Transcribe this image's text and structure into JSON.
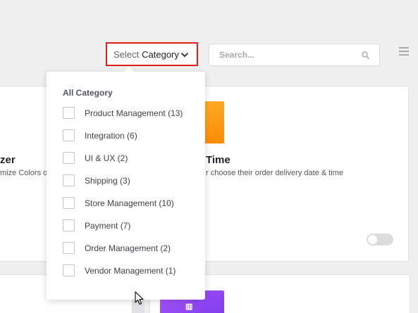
{
  "header": {
    "select_category": {
      "prefix": "Select",
      "strong": "Category",
      "icon": "chevron-down-icon"
    },
    "search": {
      "placeholder": "Search...",
      "value": "",
      "icon": "search-icon"
    },
    "menu_icon": "menu-icon"
  },
  "dropdown": {
    "heading": "All Category",
    "items": [
      {
        "label": "Product Management (13)",
        "checked": false
      },
      {
        "label": "Integration (6)",
        "checked": false
      },
      {
        "label": "UI & UX (2)",
        "checked": false
      },
      {
        "label": "Shipping (3)",
        "checked": false
      },
      {
        "label": "Store Management (10)",
        "checked": false
      },
      {
        "label": "Payment (7)",
        "checked": false
      },
      {
        "label": "Order Management (2)",
        "checked": false
      },
      {
        "label": "Vendor Management (1)",
        "checked": false
      }
    ]
  },
  "cards": {
    "left": {
      "title_fragment": "zer",
      "desc_fragment": "mize Colors o"
    },
    "right": {
      "title_fragment": "Time",
      "desc_fragment": "r choose their order delivery date & time",
      "toggle_on": false
    }
  },
  "colors": {
    "highlight_border": "#e21d1d",
    "orange_thumb": "#ff9800",
    "purple_thumb": "#8b3cf0"
  }
}
